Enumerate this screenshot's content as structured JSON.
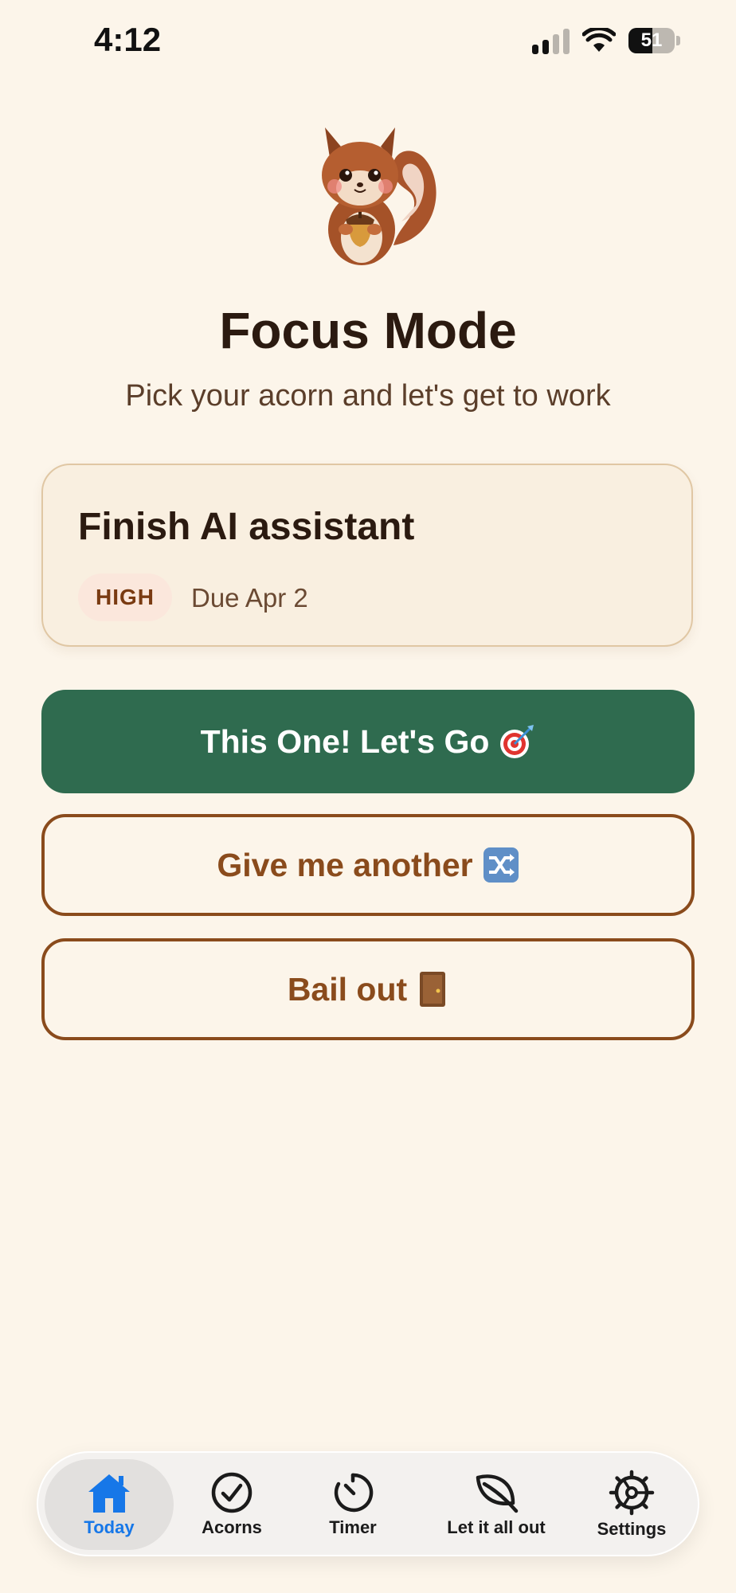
{
  "status_bar": {
    "time": "4:12",
    "battery_percent": "51",
    "battery_level": 0.51,
    "signal_bars_active": 2,
    "icons": [
      "cellular-signal-icon",
      "wifi-icon",
      "battery-icon"
    ]
  },
  "header": {
    "mascot": "squirrel-holding-acorn-illustration",
    "title": "Focus Mode",
    "subtitle": "Pick your acorn and let's get to work"
  },
  "task": {
    "title": "Finish AI assistant",
    "priority": "HIGH",
    "due": "Due Apr 2"
  },
  "actions": {
    "go_label": "This One! Let's Go",
    "go_icon": "dart-target-icon",
    "another_label": "Give me another",
    "another_icon": "shuffle-icon",
    "bail_label": "Bail out",
    "bail_icon": "door-icon"
  },
  "tabbar": {
    "active": "Today",
    "tabs": [
      {
        "label": "Today",
        "icon": "house-icon"
      },
      {
        "label": "Acorns",
        "icon": "checkmark-circle-icon"
      },
      {
        "label": "Timer",
        "icon": "timer-icon"
      },
      {
        "label": "Let it all out",
        "icon": "leaf-icon"
      },
      {
        "label": "Settings",
        "icon": "gear-icon"
      }
    ]
  },
  "colors": {
    "background": "#fcf5ea",
    "primary_button": "#2f6b4f",
    "accent_brown": "#8a4b1c",
    "active_tab": "#1677e8"
  }
}
